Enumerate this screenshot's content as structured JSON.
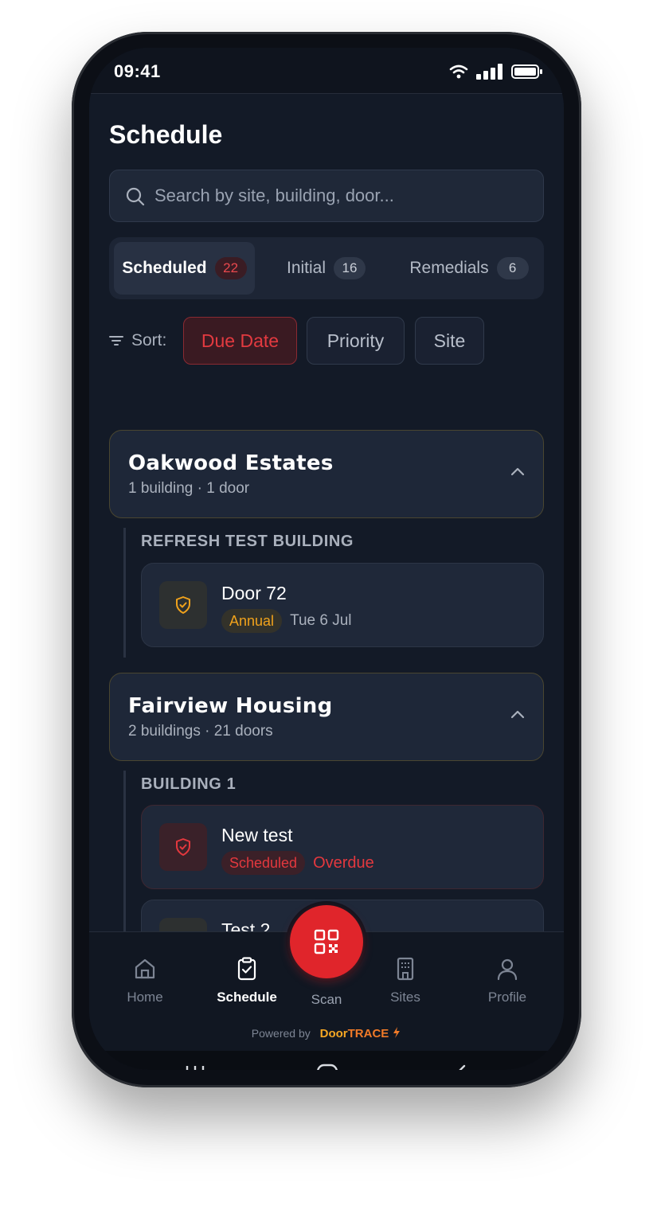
{
  "status": {
    "time": "09:41"
  },
  "header": {
    "title": "Schedule"
  },
  "search": {
    "placeholder": "Search by site, building, door..."
  },
  "tabs": [
    {
      "label": "Scheduled",
      "count": "22"
    },
    {
      "label": "Initial",
      "count": "16"
    },
    {
      "label": "Remedials",
      "count": "6"
    }
  ],
  "sort": {
    "label": "Sort:",
    "options": [
      "Due Date",
      "Priority",
      "Site"
    ]
  },
  "sites": [
    {
      "name": "Oakwood Estates",
      "meta": "1 building · 1 door",
      "buildings": [
        {
          "name": "REFRESH TEST BUILDING",
          "doors": [
            {
              "title": "Door 72",
              "tag": "Annual",
              "date": "Tue 6 Jul"
            }
          ]
        }
      ]
    },
    {
      "name": "Fairview Housing",
      "meta": "2 buildings · 21 doors",
      "buildings": [
        {
          "name": "BUILDING 1",
          "doors": [
            {
              "title": "New test",
              "tag": "Scheduled",
              "status": "Overdue"
            },
            {
              "title": "Test 2"
            }
          ]
        }
      ]
    }
  ],
  "nav": {
    "home": "Home",
    "schedule": "Schedule",
    "scan": "Scan",
    "sites": "Sites",
    "profile": "Profile"
  },
  "footer": {
    "powered_by": "Powered by",
    "brand_a": "Door",
    "brand_b": "TRACE"
  },
  "colors": {
    "accent": "#e0252b",
    "amber": "#f0a21c",
    "background": "#131a27"
  }
}
